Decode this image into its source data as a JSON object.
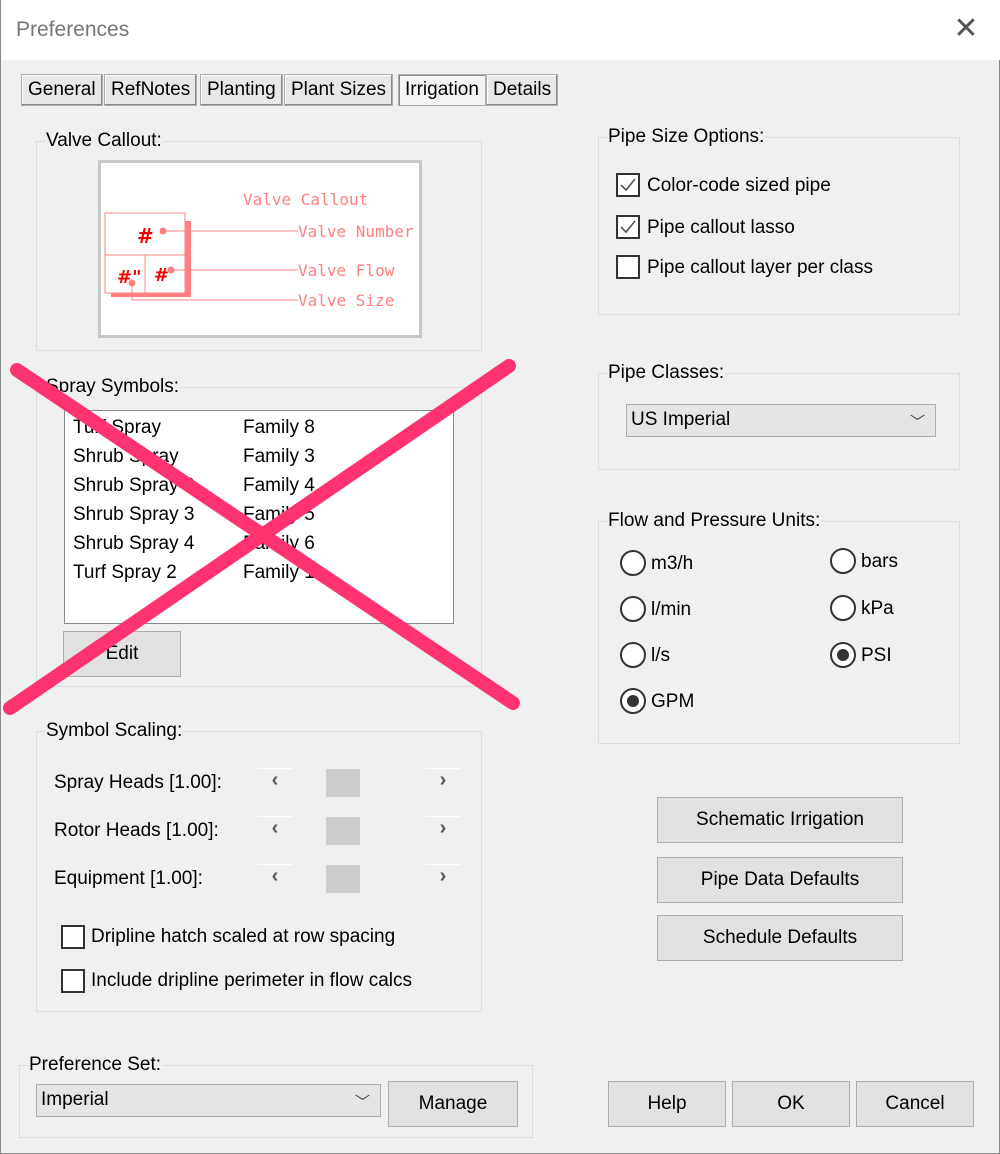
{
  "window": {
    "title": "Preferences",
    "close_icon": "close-icon"
  },
  "tabs": [
    {
      "label": "General"
    },
    {
      "label": "RefNotes"
    },
    {
      "label": "Planting"
    },
    {
      "label": "Plant Sizes"
    },
    {
      "label": "Irrigation",
      "active": true
    },
    {
      "label": "Details"
    }
  ],
  "valve_callout": {
    "label": "Valve Callout:",
    "preview": {
      "title": "Valve Callout",
      "number": "Valve Number",
      "flow": "Valve Flow",
      "size": "Valve Size",
      "number_symbol": "#",
      "size_symbol": "#\"",
      "flow_symbol": "#"
    },
    "color": "#ff8080"
  },
  "spray_symbols": {
    "label": "Spray Symbols:",
    "items": [
      {
        "name": "Turf Spray",
        "family": "Family 8"
      },
      {
        "name": "Shrub Spray",
        "family": "Family 3"
      },
      {
        "name": "Shrub Spray 2",
        "family": "Family 4"
      },
      {
        "name": "Shrub Spray 3",
        "family": "Family 5"
      },
      {
        "name": "Shrub Spray 4",
        "family": "Family 6"
      },
      {
        "name": "Turf Spray 2",
        "family": "Family 1"
      }
    ],
    "edit_label": "Edit",
    "disabled_overlay": "cross-out-x",
    "overlay_color": "#ff3370"
  },
  "symbol_scaling": {
    "label": "Symbol Scaling:",
    "sliders": [
      {
        "label": "Spray Heads [1.00]:",
        "value": 1.0
      },
      {
        "label": "Rotor Heads [1.00]:",
        "value": 1.0
      },
      {
        "label": "Equipment [1.00]:",
        "value": 1.0
      }
    ],
    "checkboxes": [
      {
        "label": "Dripline hatch scaled at row spacing",
        "checked": false
      },
      {
        "label": "Include dripline perimeter in flow calcs",
        "checked": false
      }
    ]
  },
  "preference_set": {
    "label": "Preference Set:",
    "value": "Imperial",
    "manage_label": "Manage"
  },
  "pipe_size_options": {
    "label": "Pipe Size Options:",
    "checkboxes": [
      {
        "label": "Color-code sized pipe",
        "checked": true
      },
      {
        "label": "Pipe callout lasso",
        "checked": true
      },
      {
        "label": "Pipe callout layer per class",
        "checked": false
      }
    ]
  },
  "pipe_classes": {
    "label": "Pipe Classes:",
    "value": "US Imperial"
  },
  "units": {
    "label": "Flow and Pressure Units:",
    "flow": [
      {
        "label": "m3/h",
        "selected": false
      },
      {
        "label": "l/min",
        "selected": false
      },
      {
        "label": "l/s",
        "selected": false
      },
      {
        "label": "GPM",
        "selected": true
      }
    ],
    "pressure": [
      {
        "label": "bars",
        "selected": false
      },
      {
        "label": "kPa",
        "selected": false
      },
      {
        "label": "PSI",
        "selected": true
      }
    ]
  },
  "buttons": {
    "schematic": "Schematic Irrigation",
    "pipe_data": "Pipe Data Defaults",
    "schedule": "Schedule Defaults",
    "help": "Help",
    "ok": "OK",
    "cancel": "Cancel"
  }
}
